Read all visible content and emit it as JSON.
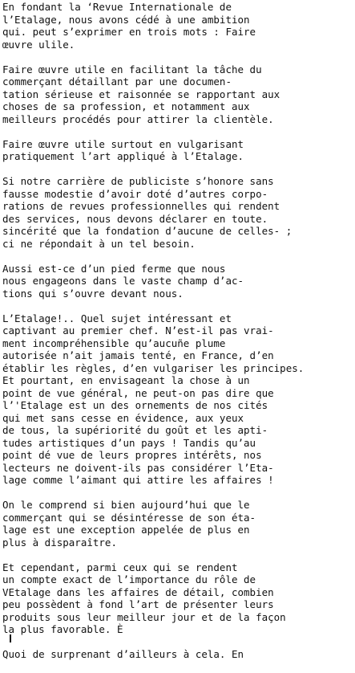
{
  "document": {
    "paragraphs": [
      {
        "lines": [
          "En fondant la ‘Revue Internationale de",
          "l’Etalage, nous avons cédé à une ambition",
          "qui. peut s’exprimer en trois mots : Faire",
          "œuvre ulile."
        ]
      },
      {
        "lines": [
          "Faire œuvre utile en facilitant la tâche du",
          "commerçant détaillant par une documen-",
          "tation sérieuse et raisonnée se rapportant aux",
          "choses de sa profession, et notamment aux",
          "meilleurs procédés pour attirer la clientèle."
        ]
      },
      {
        "lines": [
          "Faire œuvre utile surtout en vulgarisant",
          "pratiquement l’art appliqué à l’Etalage."
        ]
      },
      {
        "lines": [
          "Si notre carrière de publiciste s’honore sans",
          "fausse modestie d’avoir doté d’autres corpo-",
          "rations de revues professionnelles qui rendent",
          "des services, nous devons déclarer en toute.",
          "sincérité que la fondation d’aucune de celles- ;",
          "ci ne répondait à un tel besoin."
        ]
      },
      {
        "lines": [
          "Aussi est-ce d’un pied ferme que nous",
          "nous engageons dans le vaste champ d’ac-",
          "tions qui s’ouvre devant nous."
        ]
      },
      {
        "lines": [
          "L’Etalage!.. Quel sujet intéressant et",
          "captivant au premier chef. N’est-il pas vrai-",
          "ment incompréhensible qu’aucuñe plume",
          "autorisée n’ait jamais tenté, en France, d’en",
          "établir les règles, d’en vulgariser les principes.",
          "Et pourtant, en envisageant la chose à un",
          "point de vue général, ne peut-on pas dire que",
          "l’'Etalage est un des ornements de nos cités",
          "qui met sans cesse en évidence, aux yeux",
          "de tous, la supériorité du goût et les apti-",
          "tudes artistiques d’un pays ! Tandis qu’au",
          "point dé vue de leurs propres intérêts, nos",
          "lecteurs ne doivent-ils pas considérer l’Eta-",
          "lage comme l’aimant qui attire les affaires !"
        ]
      },
      {
        "lines": [
          "On le comprend si bien aujourd’hui que le",
          "commerçant qui se désintéresse de son éta-",
          "lage est une exception appelée de plus en",
          "plus à disparaître."
        ]
      },
      {
        "lines": [
          "Et cependant, parmi ceux qui se rendent",
          "un compte exact de l’importance du rôle de",
          "VEtalage dans les affaires de détail, combien",
          "peu possèdent à fond l’art de présenter leurs",
          "produits sous leur meilleur jour et de la façon",
          "la plus favorable. È"
        ]
      },
      {
        "lines": [
          "Quoi de surprenant d’ailleurs à cela. En"
        ]
      }
    ]
  }
}
